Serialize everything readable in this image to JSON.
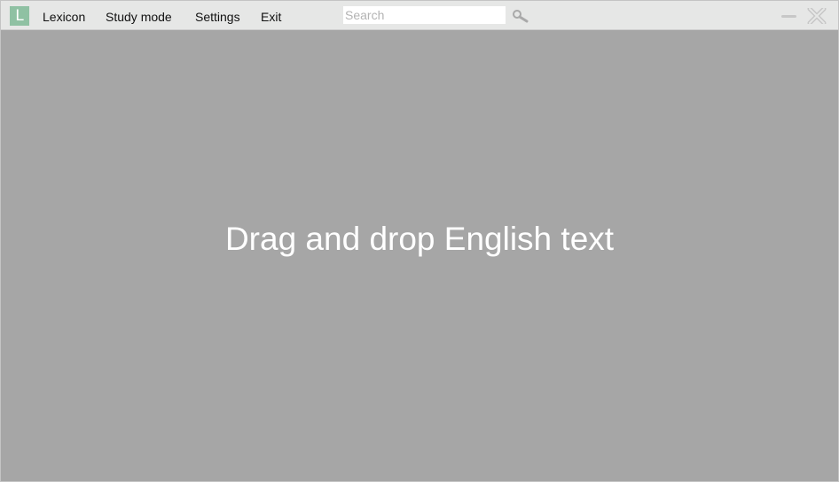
{
  "app": {
    "logo_letter": "L",
    "logo_icon": "app-logo-icon",
    "accent_color": "#8fc1a3",
    "background_color": "#a6a6a6"
  },
  "menu": {
    "items": [
      {
        "label": "Lexicon"
      },
      {
        "label": "Study mode"
      },
      {
        "label": "Settings"
      },
      {
        "label": "Exit"
      }
    ]
  },
  "search": {
    "value": "",
    "placeholder": "Search",
    "icon": "search-icon"
  },
  "window_controls": {
    "minimize_icon": "minimize-icon",
    "close_icon": "close-icon"
  },
  "main": {
    "drop_hint": "Drag and drop English text"
  }
}
